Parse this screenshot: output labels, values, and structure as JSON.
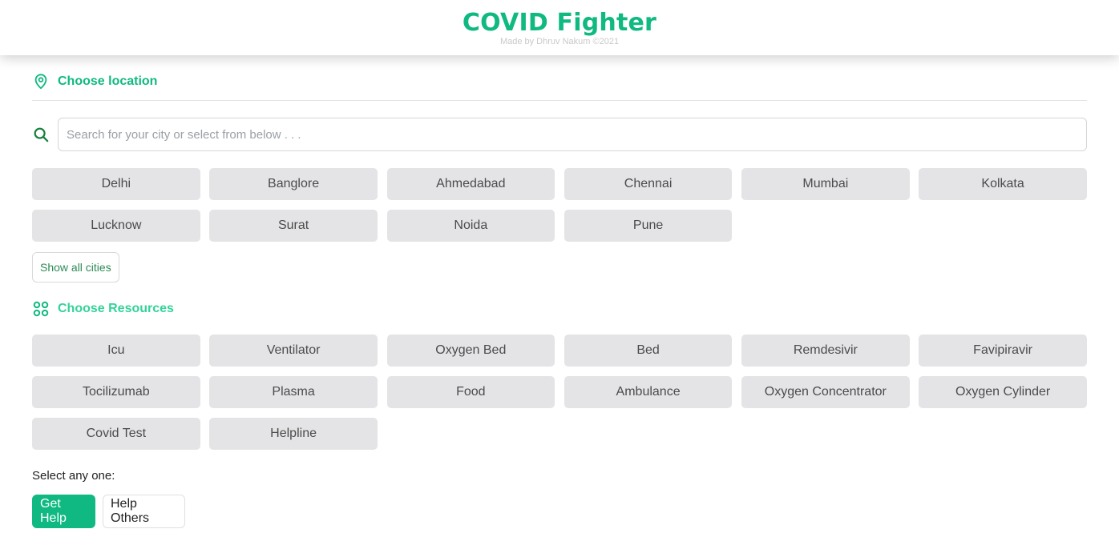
{
  "header": {
    "title": "COVID Fighter",
    "subtitle": "Made by Dhruv Nakum ©2021"
  },
  "location": {
    "heading": "Choose location",
    "heading_icon": "map-pin-icon",
    "search_icon": "search-icon",
    "search_placeholder": "Search for your city or select from below . . .",
    "search_value": "",
    "cities": [
      "Delhi",
      "Banglore",
      "Ahmedabad",
      "Chennai",
      "Mumbai",
      "Kolkata",
      "Lucknow",
      "Surat",
      "Noida",
      "Pune"
    ],
    "show_all_label": "Show all cities"
  },
  "resources": {
    "heading": "Choose Resources",
    "heading_icon": "grid-icon",
    "items": [
      "Icu",
      "Ventilator",
      "Oxygen Bed",
      "Bed",
      "Remdesivir",
      "Favipiravir",
      "Tocilizumab",
      "Plasma",
      "Food",
      "Ambulance",
      "Oxygen Concentrator",
      "Oxygen Cylinder",
      "Covid Test",
      "Helpline"
    ]
  },
  "action": {
    "prompt": "Select any one:",
    "get_help_label": "Get Help",
    "help_others_label": "Help Others"
  },
  "colors": {
    "brand": "#10b981",
    "chip_bg": "#e4e4e7"
  }
}
